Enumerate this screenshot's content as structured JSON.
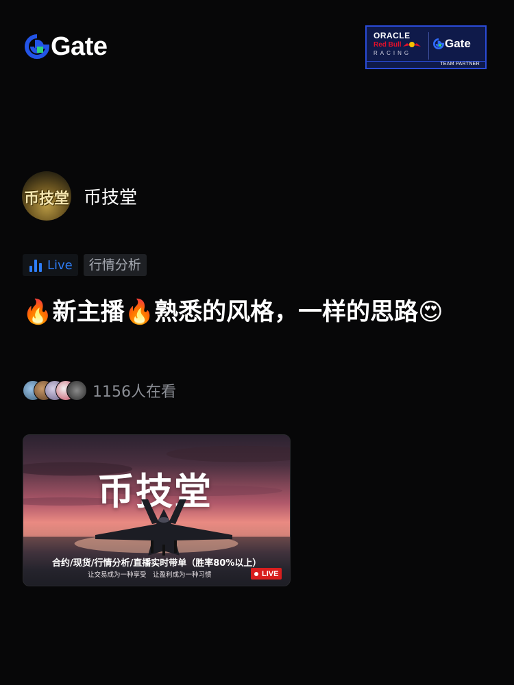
{
  "header": {
    "logo_text": "Gate",
    "brand_color": "#2354e6",
    "partner": {
      "oracle": "ORACLE",
      "redbull": "Red Bull",
      "racing": "RACING",
      "gate": "Gate",
      "strip": "TEAM PARTNER"
    }
  },
  "host": {
    "avatar_text": "币技堂",
    "name": "币技堂"
  },
  "tags": {
    "live_label": "Live",
    "category": "行情分析",
    "accent": "#2e7df7"
  },
  "stream": {
    "title": "🔥新主播🔥熟悉的风格，一样的思路😍",
    "viewers": "1156人在看"
  },
  "cover": {
    "title": "币技堂",
    "caption": "合约/现货/行情分析/直播实时带单（胜率80%以上）",
    "subcaption": "让交易成为一种享受　让盈利成为一种习惯",
    "live_badge": "LIVE",
    "badge_color": "#d81e1e"
  }
}
